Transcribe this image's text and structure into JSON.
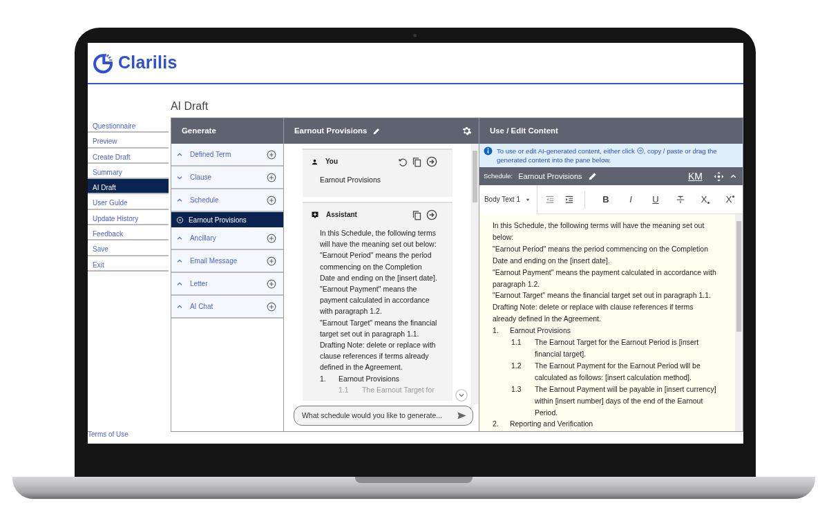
{
  "brand": {
    "name": "Clarilis"
  },
  "nav": [
    {
      "label": "Questionnaire",
      "selected": false
    },
    {
      "label": "Preview",
      "selected": false
    },
    {
      "label": "Create Draft",
      "selected": false
    },
    {
      "label": "Summary",
      "selected": false
    },
    {
      "label": "AI Draft",
      "selected": true
    },
    {
      "label": "User Guide",
      "selected": false
    },
    {
      "label": "Update History",
      "selected": false
    },
    {
      "label": "Feedback",
      "selected": false
    },
    {
      "label": "Save",
      "selected": false
    },
    {
      "label": "Exit",
      "selected": false
    }
  ],
  "footer_links": [
    "Terms of Use"
  ],
  "page_title": "AI Draft",
  "generate": {
    "title": "Generate",
    "sections": [
      {
        "label": "Defined Term",
        "expanded": true
      },
      {
        "label": "Clause",
        "expanded": false
      },
      {
        "label": "Schedule",
        "expanded": true,
        "children": [
          {
            "label": "Earnout Provisions",
            "selected": true
          }
        ]
      },
      {
        "label": "Ancillary",
        "expanded": true
      },
      {
        "label": "Email Message",
        "expanded": true
      },
      {
        "label": "Letter",
        "expanded": true
      },
      {
        "label": "AI Chat",
        "expanded": true
      }
    ]
  },
  "chat": {
    "title": "Earnout Provisions",
    "messages": [
      {
        "kind": "user",
        "author": "You",
        "paragraphs": [
          "Earnout Provisions"
        ]
      },
      {
        "kind": "assistant",
        "author": "Assistant",
        "paragraphs": [
          "In this Schedule, the following terms will have the meaning set out below:",
          "\"Earnout Period\" means the period commencing on the Completion Date and ending on the [insert date].",
          "\"Earnout Payment\" means the payment calculated in accordance with paragraph 1.2.",
          "\"Earnout Target\" means the financial target set out in paragraph 1.1.",
          "Drafting Note: delete or replace with clause references if terms already defined in the Agreement."
        ],
        "items": [
          {
            "number": "1.",
            "text": "Earnout Provisions",
            "children": [
              {
                "number": "1.1",
                "text": "The Earnout Target for"
              }
            ]
          }
        ]
      }
    ],
    "input": {
      "placeholder": "What schedule would you like to generate..."
    }
  },
  "editor": {
    "title": "Use / Edit Content",
    "notice_before": "To use or edit AI-generated content, either click",
    "notice_after": ", copy / paste or drag the generated content into the pane below.",
    "schedule_label": "Schedule:",
    "schedule_title": "Earnout Provisions",
    "badge": "KM",
    "style": "Body Text 1",
    "tools": [
      {
        "kind": "outdent"
      },
      {
        "kind": "indent"
      },
      {
        "kind": "sep"
      },
      {
        "kind": "bold",
        "glyph": "B"
      },
      {
        "kind": "italic",
        "glyph": "I"
      },
      {
        "kind": "underline",
        "glyph": "U"
      },
      {
        "kind": "strike"
      },
      {
        "kind": "subscript",
        "glyph": "X"
      },
      {
        "kind": "superscript",
        "glyph": "X"
      }
    ],
    "paragraphs": [
      "In this Schedule, the following terms will have the meaning set out below:",
      "\"Earnout Period\" means the period commencing on the Completion Date and ending on the [insert date].",
      "\"Earnout Payment\" means the payment calculated in accordance with paragraph 1.2.",
      "\"Earnout Target\" means the financial target set out in paragraph 1.1.",
      "Drafting Note: delete or replace with clause references if terms already defined in the Agreement."
    ],
    "items": [
      {
        "number": "1.",
        "text": "Earnout Provisions",
        "children": [
          {
            "number": "1.1",
            "text": "The Earnout Target for the Earnout Period is [insert financial target]."
          },
          {
            "number": "1.2",
            "text": "The Earnout Payment for the Earnout Period will be calculated as follows: [insert calculation method]."
          },
          {
            "number": "1.3",
            "text": "The Earnout Payment will be payable in [insert currency] within [insert number] days of the end of the Earnout Period."
          }
        ]
      },
      {
        "number": "2.",
        "text": "Reporting and Verification"
      }
    ]
  }
}
